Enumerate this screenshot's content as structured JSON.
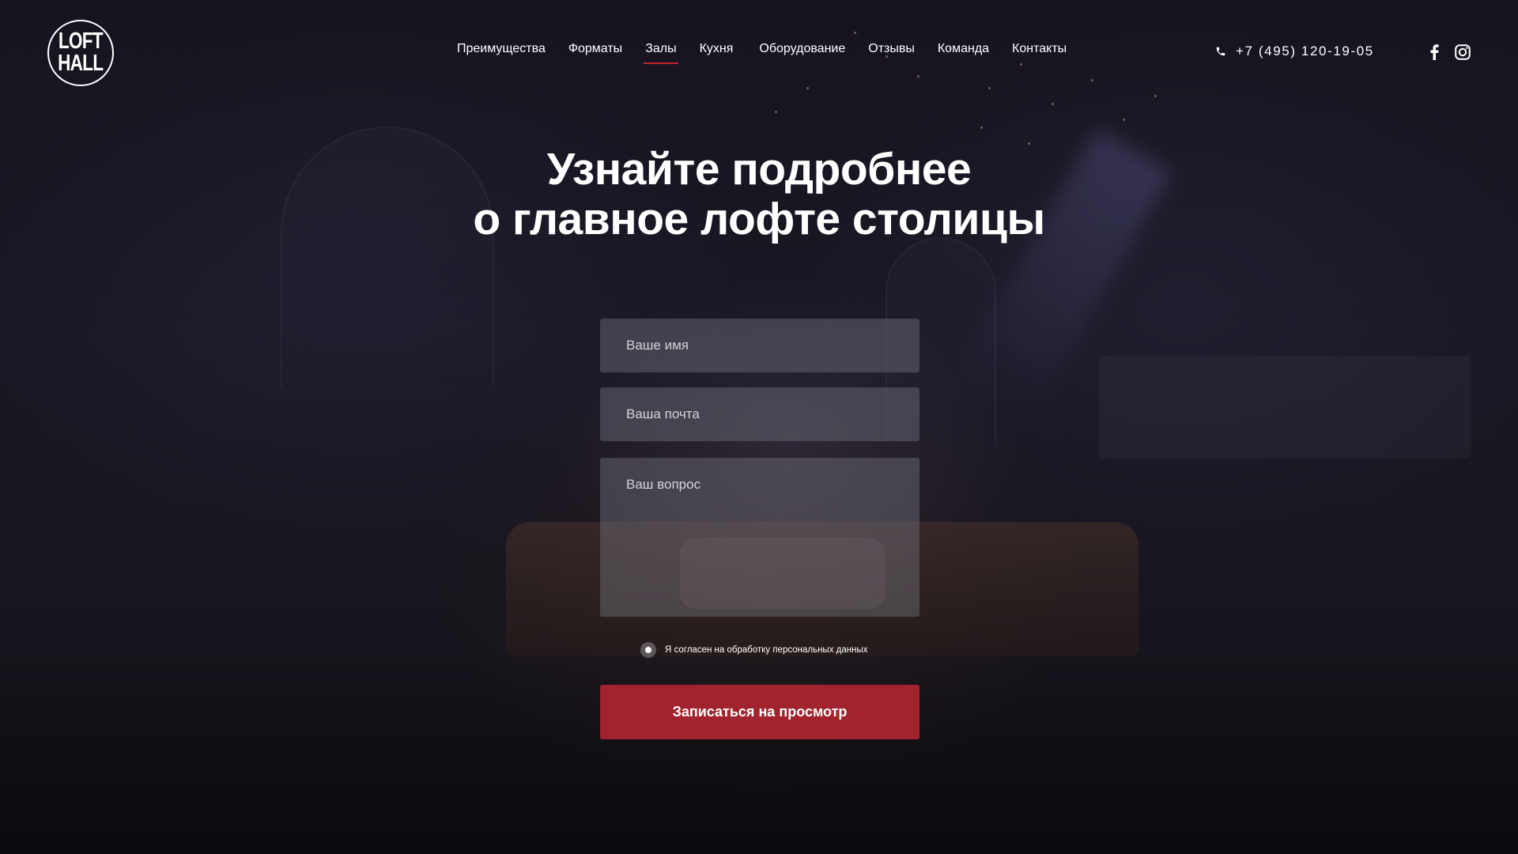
{
  "logo": {
    "line1": "LOFT",
    "line2": "HALL"
  },
  "nav": {
    "items": [
      {
        "label": "Преимущества"
      },
      {
        "label": "Форматы"
      },
      {
        "label": "Залы",
        "active": true
      },
      {
        "label": "Кухня"
      },
      {
        "label": "Оборудование"
      },
      {
        "label": "Отзывы"
      },
      {
        "label": "Команда"
      },
      {
        "label": "Контакты"
      }
    ]
  },
  "contact": {
    "phone": "+7 (495) 120-19-05",
    "phone_icon": "phone-icon"
  },
  "social": {
    "facebook_icon": "facebook-icon",
    "instagram_icon": "instagram-icon"
  },
  "hero": {
    "title_line1": "Узнайте подробнее",
    "title_line2": "о главное лофте столицы"
  },
  "form": {
    "name_placeholder": "Ваше имя",
    "email_placeholder": "Ваша почта",
    "question_placeholder": "Ваш вопрос",
    "consent_label": "Я согласен на обработку персональных данных",
    "consent_checked": true,
    "submit_label": "Записаться на просмотр"
  },
  "colors": {
    "accent": "#a0232d",
    "nav_active_underline": "#c0262f",
    "background": "#14121c",
    "text": "#ffffff"
  }
}
